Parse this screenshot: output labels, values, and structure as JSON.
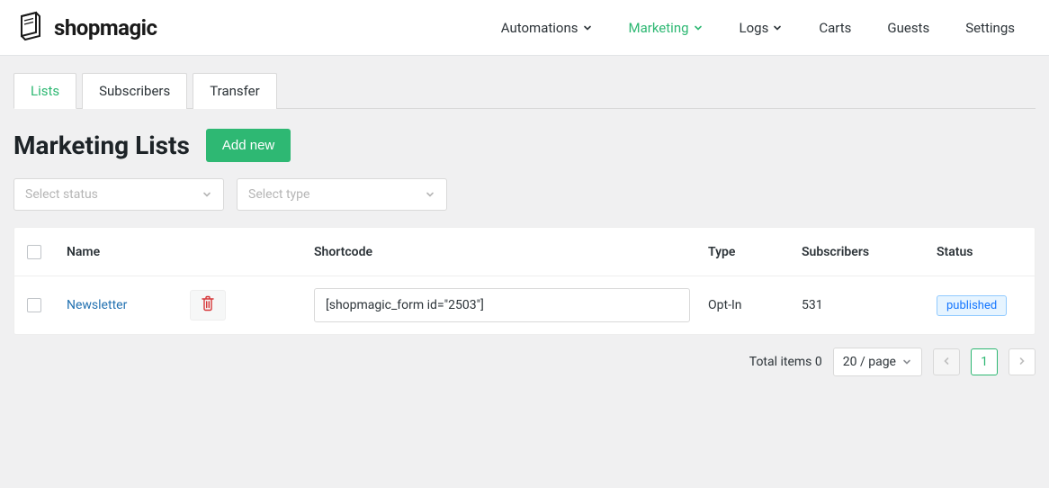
{
  "brand": {
    "name": "shopmagic"
  },
  "nav": {
    "automations": "Automations",
    "marketing": "Marketing",
    "logs": "Logs",
    "carts": "Carts",
    "guests": "Guests",
    "settings": "Settings"
  },
  "tabs": {
    "lists": "Lists",
    "subscribers": "Subscribers",
    "transfer": "Transfer"
  },
  "page": {
    "title": "Marketing Lists",
    "add_new": "Add new"
  },
  "filters": {
    "status_placeholder": "Select status",
    "type_placeholder": "Select type"
  },
  "table": {
    "headers": {
      "name": "Name",
      "shortcode": "Shortcode",
      "type": "Type",
      "subscribers": "Subscribers",
      "status": "Status"
    },
    "rows": [
      {
        "name": "Newsletter",
        "shortcode": "[shopmagic_form id=\"2503\"]",
        "type": "Opt-In",
        "subscribers": "531",
        "status": "published"
      }
    ]
  },
  "pagination": {
    "total_label": "Total items 0",
    "page_size": "20 / page",
    "current": "1"
  }
}
